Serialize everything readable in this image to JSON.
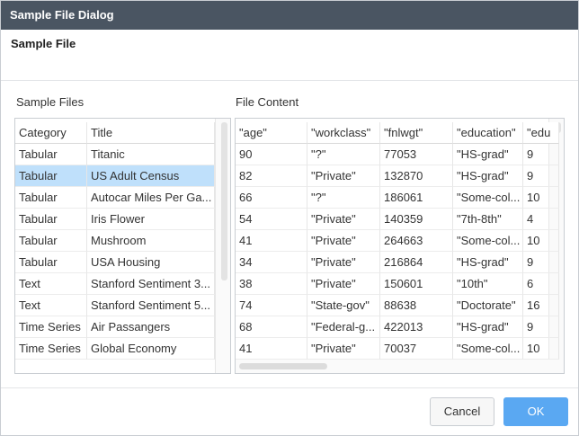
{
  "dialog": {
    "title": "Sample File Dialog",
    "subtitle": "Sample File"
  },
  "sample_files": {
    "label": "Sample Files",
    "columns": [
      "Category",
      "Title"
    ],
    "selected_index": 1,
    "rows": [
      [
        "Tabular",
        "Titanic"
      ],
      [
        "Tabular",
        "US Adult Census"
      ],
      [
        "Tabular",
        "Autocar Miles Per Ga..."
      ],
      [
        "Tabular",
        "Iris Flower"
      ],
      [
        "Tabular",
        "Mushroom"
      ],
      [
        "Tabular",
        "USA Housing"
      ],
      [
        "Text",
        "Stanford Sentiment 3..."
      ],
      [
        "Text",
        "Stanford Sentiment 5..."
      ],
      [
        "Time Series",
        "Air Passangers"
      ],
      [
        "Time Series",
        "Global Economy"
      ]
    ]
  },
  "file_content": {
    "label": "File Content",
    "columns": [
      "\"age\"",
      "\"workclass\"",
      "\"fnlwgt\"",
      "\"education\"",
      "\"edu"
    ],
    "rows": [
      [
        "90",
        "\"?\"",
        "77053",
        "\"HS-grad\"",
        "9"
      ],
      [
        "82",
        "\"Private\"",
        "132870",
        "\"HS-grad\"",
        "9"
      ],
      [
        "66",
        "\"?\"",
        "186061",
        "\"Some-col...",
        "10"
      ],
      [
        "54",
        "\"Private\"",
        "140359",
        "\"7th-8th\"",
        "4"
      ],
      [
        "41",
        "\"Private\"",
        "264663",
        "\"Some-col...",
        "10"
      ],
      [
        "34",
        "\"Private\"",
        "216864",
        "\"HS-grad\"",
        "9"
      ],
      [
        "38",
        "\"Private\"",
        "150601",
        "\"10th\"",
        "6"
      ],
      [
        "74",
        "\"State-gov\"",
        "88638",
        "\"Doctorate\"",
        "16"
      ],
      [
        "68",
        "\"Federal-g...",
        "422013",
        "\"HS-grad\"",
        "9"
      ],
      [
        "41",
        "\"Private\"",
        "70037",
        "\"Some-col...",
        "10"
      ]
    ]
  },
  "buttons": {
    "cancel": "Cancel",
    "ok": "OK"
  }
}
